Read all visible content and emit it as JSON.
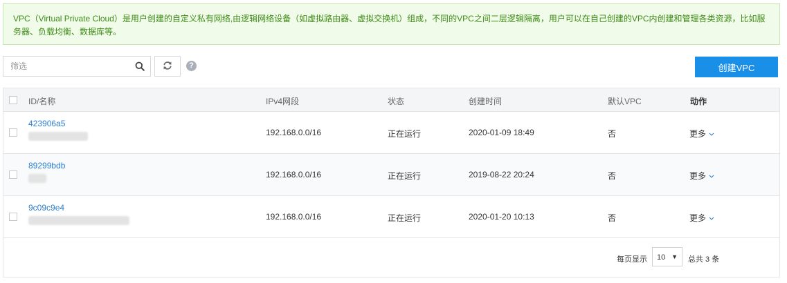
{
  "notice": {
    "text": "VPC（Virtual Private Cloud）是用户创建的自定义私有网络,由逻辑网络设备（如虚拟路由器、虚拟交换机）组成，不同的VPC之间二层逻辑隔离，用户可以在自己创建的VPC内创建和管理各类资源，比如服务器、负载均衡、数据库等。"
  },
  "toolbar": {
    "filter_placeholder": "筛选",
    "help_label": "?",
    "create_label": "创建VPC"
  },
  "table": {
    "headers": {
      "id_name": "ID/名称",
      "ipv4": "IPv4网段",
      "status": "状态",
      "created": "创建时间",
      "default_vpc": "默认VPC",
      "action": "动作"
    },
    "rows": [
      {
        "id": "423906a5",
        "ipv4": "192.168.0.0/16",
        "status": "正在运行",
        "created": "2020-01-09 18:49",
        "default_vpc": "否",
        "action": "更多"
      },
      {
        "id": "89299bdb",
        "ipv4": "192.168.0.0/16",
        "status": "正在运行",
        "created": "2019-08-22 20:24",
        "default_vpc": "否",
        "action": "更多"
      },
      {
        "id": "9c09c9e4",
        "ipv4": "192.168.0.0/16",
        "status": "正在运行",
        "created": "2020-01-20 10:13",
        "default_vpc": "否",
        "action": "更多"
      }
    ]
  },
  "pagination": {
    "per_page_label": "每页显示",
    "page_size": "10",
    "total_label": "总共 3 条"
  },
  "colors": {
    "primary": "#1a8fe8",
    "link": "#2b7fd0",
    "notice_bg": "#f0fbe9",
    "notice_text": "#3f8a17"
  },
  "icons": {
    "search": "search-icon",
    "refresh": "refresh-icon",
    "help": "help-icon",
    "dropdown": "chevron-down-icon"
  }
}
